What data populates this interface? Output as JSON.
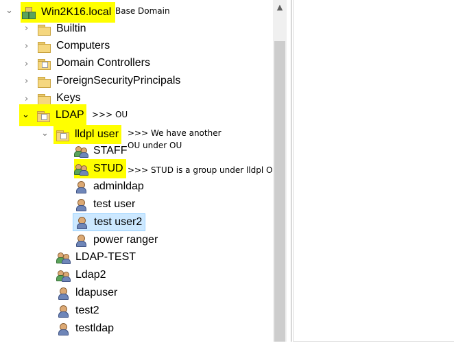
{
  "tree": {
    "domain": {
      "label": "Win2K16.local",
      "note": "Base Domain",
      "icon": "domain-icon"
    },
    "containers": [
      {
        "label": "Builtin",
        "icon": "folder-icon"
      },
      {
        "label": "Computers",
        "icon": "folder-icon"
      },
      {
        "label": "Domain Controllers",
        "icon": "ou-icon"
      },
      {
        "label": "ForeignSecurityPrincipals",
        "icon": "folder-icon"
      },
      {
        "label": "Keys",
        "icon": "folder-icon"
      }
    ],
    "ldap": {
      "label": "LDAP",
      "note": ">>> OU",
      "icon": "ou-icon"
    },
    "lldpl": {
      "label": "lldpl user",
      "note_line1": ">>> We have another",
      "note_line2": "OU under OU",
      "icon": "ou-icon"
    },
    "lldpl_children": {
      "staff": "STAFF",
      "stud": "STUD",
      "stud_note": ">>> STUD is a group under lldpl OU",
      "adminldap": "adminldap",
      "test_user": "test user",
      "test_user2": "test user2",
      "power_ranger": "power ranger"
    },
    "ldap_children": {
      "ldap_test": "LDAP-TEST",
      "ldap2": "Ldap2",
      "ldapuser": "ldapuser",
      "test2": "test2",
      "testldap": "testldap"
    }
  },
  "colors": {
    "highlight": "#ffff00",
    "selection": "#cce8ff"
  }
}
